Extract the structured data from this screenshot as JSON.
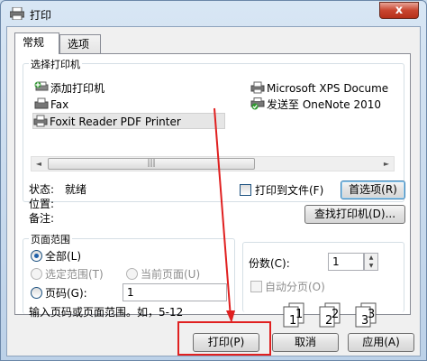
{
  "window": {
    "title": "打印",
    "close_glyph": "x"
  },
  "tabs": [
    {
      "label": "常规",
      "active": true
    },
    {
      "label": "选项",
      "active": false
    }
  ],
  "printer_select": {
    "group_title": "选择打印机",
    "printers": [
      {
        "name": "添加打印机",
        "icon": "add-printer-icon",
        "selected": false
      },
      {
        "name": "Fax",
        "icon": "fax-printer-icon",
        "selected": false
      },
      {
        "name": "Foxit Reader PDF Printer",
        "icon": "printer-icon",
        "selected": true
      },
      {
        "name": "Microsoft XPS Docume",
        "icon": "printer-icon",
        "selected": false
      },
      {
        "name": "发送至 OneNote 2010",
        "icon": "default-printer-icon",
        "selected": false
      }
    ],
    "scroll_left": "◄",
    "scroll_right": "►",
    "scroll_grip": "|||",
    "status_label": "状态:",
    "status_value": "就绪",
    "location_label": "位置:",
    "comment_label": "备注:",
    "print_to_file_label": "打印到文件(F)",
    "preferences_button": "首选项(R)",
    "find_printer_button": "查找打印机(D)..."
  },
  "page_range": {
    "group_title": "页面范围",
    "all_label": "全部(L)",
    "selection_label": "选定范围(T)",
    "current_page_label": "当前页面(U)",
    "pages_label": "页码(G):",
    "pages_value": "1",
    "hint": "输入页码或页面范围。如，5-12"
  },
  "copies": {
    "label": "份数(C):",
    "value": "1",
    "collate_label": "自动分页(O)",
    "collate_pages": [
      "1",
      "1",
      "2",
      "2",
      "3",
      "3"
    ]
  },
  "buttons": {
    "print": "打印(P)",
    "cancel": "取消",
    "apply": "应用(A)"
  },
  "colors": {
    "annotation": "#e02020",
    "focus_border": "#3c7fb1"
  }
}
